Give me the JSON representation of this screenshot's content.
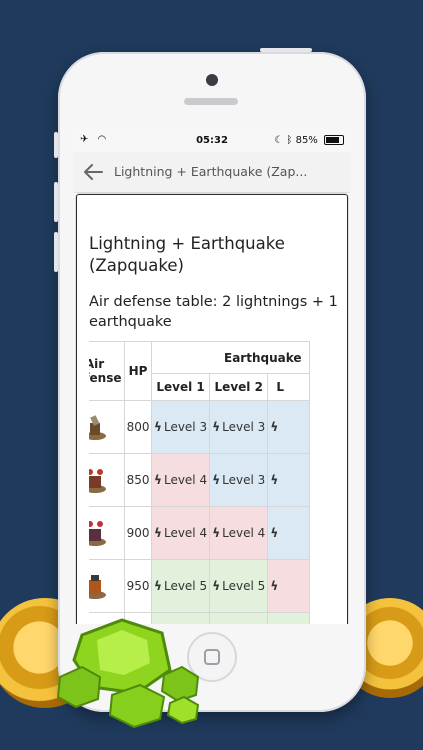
{
  "status_bar": {
    "time": "05:32",
    "battery": "85%"
  },
  "app_bar": {
    "title": "Lightning + Earthquake (Zap..."
  },
  "page": {
    "title": "Lightning + Earthquake (Zapquake)",
    "section_title": "Air defense table: 2 lightnings + 1 earthquake"
  },
  "table": {
    "headers": {
      "air_defense": "Air defense",
      "hp": "HP",
      "earthquake": "Earthquake"
    },
    "level_headers": [
      "Level 1",
      "Level 2",
      "L"
    ],
    "rows": [
      {
        "hp": "800",
        "cells": [
          {
            "text": "Level 3",
            "color": "blue"
          },
          {
            "text": "Level 3",
            "color": "blue"
          },
          {
            "text": "",
            "color": "blue"
          }
        ]
      },
      {
        "hp": "850",
        "cells": [
          {
            "text": "Level 4",
            "color": "pink"
          },
          {
            "text": "Level 3",
            "color": "blue"
          },
          {
            "text": "",
            "color": "blue"
          }
        ]
      },
      {
        "hp": "900",
        "cells": [
          {
            "text": "Level 4",
            "color": "pink"
          },
          {
            "text": "Level 4",
            "color": "pink"
          },
          {
            "text": "",
            "color": "blue"
          }
        ]
      },
      {
        "hp": "950",
        "cells": [
          {
            "text": "Level 5",
            "color": "green"
          },
          {
            "text": "Level 5",
            "color": "green"
          },
          {
            "text": "",
            "color": "pink"
          }
        ]
      },
      {
        "hp": "",
        "cells": [
          {
            "text": "",
            "color": "green"
          },
          {
            "text": "",
            "color": "green"
          },
          {
            "text": "",
            "color": "green"
          }
        ]
      }
    ],
    "bolt_icon": "lightning-icon"
  },
  "colors": {
    "background": "#1f3a5c",
    "blue_cell": "#dbe9f5",
    "pink_cell": "#f5dde0",
    "green_cell": "#e1f1dc"
  }
}
